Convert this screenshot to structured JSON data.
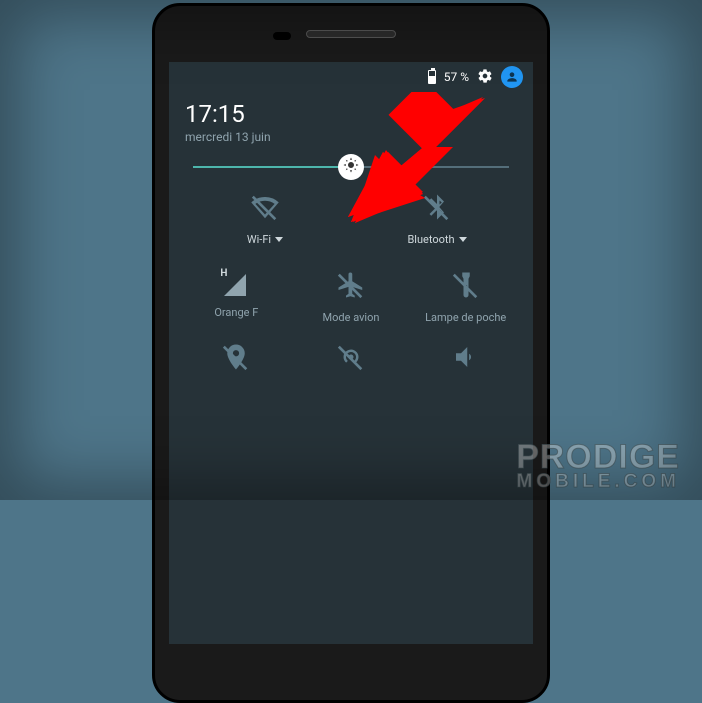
{
  "statusbar": {
    "battery_percent": "57 %"
  },
  "header": {
    "time": "17:15",
    "date": "mercredi 13 juin"
  },
  "brightness": {
    "value_percent": 50
  },
  "row1": {
    "wifi_label": "Wi-Fi",
    "bluetooth_label": "Bluetooth"
  },
  "row2": {
    "signal_label": "Orange F",
    "airplane_label": "Mode avion",
    "torch_label": "Lampe de poche"
  },
  "watermark": {
    "line1": "PRODIGE",
    "line2": "MOBILE.COM"
  }
}
